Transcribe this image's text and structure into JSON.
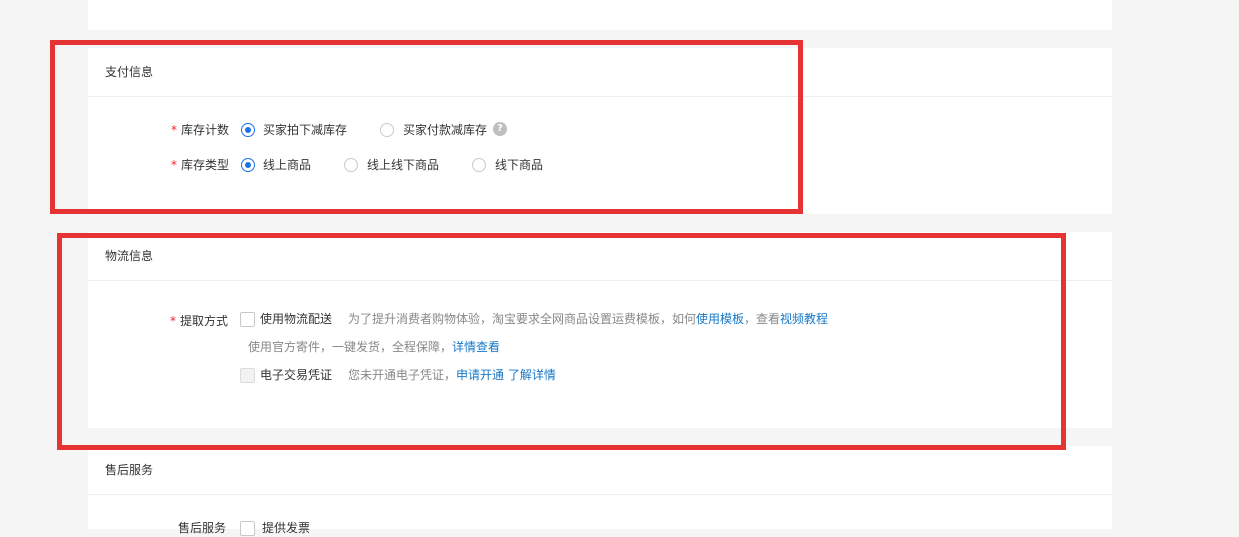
{
  "payment": {
    "title": "支付信息",
    "stock_count": {
      "required_mark": "*",
      "label": "库存计数",
      "options": [
        "买家拍下减库存",
        "买家付款减库存"
      ],
      "selected": 0,
      "help_icon": "question-circle-icon",
      "help_glyph": "?"
    },
    "stock_type": {
      "required_mark": "*",
      "label": "库存类型",
      "options": [
        "线上商品",
        "线上线下商品",
        "线下商品"
      ],
      "selected": 0
    }
  },
  "logistics": {
    "title": "物流信息",
    "pickup": {
      "required_mark": "*",
      "label": "提取方式",
      "logistics_delivery": {
        "label": "使用物流配送",
        "checked": false,
        "hint": "为了提升消费者购物体验，淘宝要求全网商品设置运费模板，如何",
        "link_template": "使用模板",
        "hint_mid": "，查看",
        "link_video": "视频教程",
        "sub_hint": "使用官方寄件，一键发货，全程保障，",
        "link_details": "详情查看"
      },
      "e_voucher": {
        "label": "电子交易凭证",
        "checked": false,
        "disabled": true,
        "hint": "您未开通电子凭证，",
        "link_apply": "申请开通",
        "link_more": "了解详情"
      }
    }
  },
  "after_sale": {
    "title": "售后服务",
    "row_label": "售后服务",
    "first_option": "提供发票"
  },
  "colors": {
    "accent": "#1a73e8",
    "link": "#1778c7",
    "required": "#f5222d",
    "highlight_box": "#e63434"
  }
}
